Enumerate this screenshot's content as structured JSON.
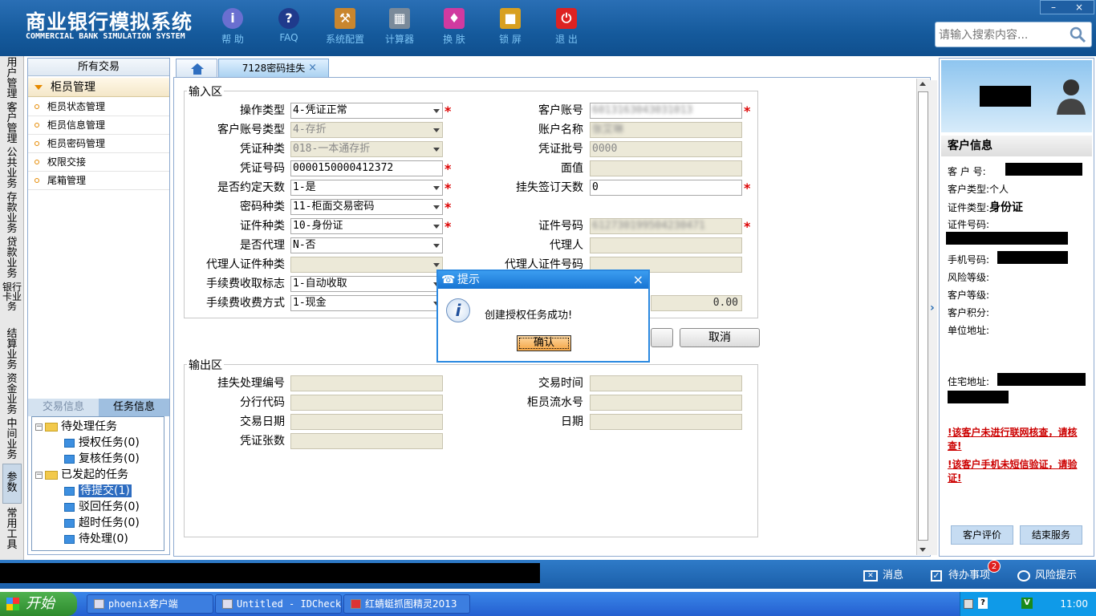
{
  "header": {
    "title": "商业银行模拟系统",
    "subtitle": "COMMERCIAL BANK SIMULATION SYSTEM",
    "toolbar": [
      {
        "label": "帮 助",
        "icon": "info-icon"
      },
      {
        "label": "FAQ",
        "icon": "question-icon"
      },
      {
        "label": "系统配置",
        "icon": "toolbox-icon"
      },
      {
        "label": "计算器",
        "icon": "calculator-icon"
      },
      {
        "label": "换 肤",
        "icon": "shirt-icon"
      },
      {
        "label": "锁 屏",
        "icon": "lock-icon"
      },
      {
        "label": "退 出",
        "icon": "power-icon"
      }
    ],
    "search_placeholder": "请输入搜索内容..."
  },
  "vtabs": [
    "用户管理",
    "客户管理",
    "公共业务",
    "存款业务",
    "贷款业务",
    "银行卡业务",
    "结算业务",
    "资金业务",
    "中间业务",
    "参数",
    "常用工具"
  ],
  "left": {
    "all_transactions": "所有交易",
    "section": "柜员管理",
    "items": [
      "柜员状态管理",
      "柜员信息管理",
      "柜员密码管理",
      "权限交接",
      "尾箱管理"
    ],
    "tabs": [
      "交易信息",
      "任务信息"
    ],
    "tree": {
      "pending": "待处理任务",
      "auth": "授权任务(0)",
      "review": "复核任务(0)",
      "initiated": "已发起的任务",
      "to_submit": "待提交(1)",
      "rejected": "驳回任务(0)",
      "timeout": "超时任务(0)",
      "processing": "待处理(0)"
    }
  },
  "tab": {
    "label": "7128密码挂失",
    "close": "×"
  },
  "input_area": {
    "title": "输入区",
    "left_fields": [
      {
        "label": "操作类型",
        "value": "4-凭证正常"
      },
      {
        "label": "客户账号类型",
        "value": "4-存折"
      },
      {
        "label": "凭证种类",
        "value": "018-一本通存折"
      },
      {
        "label": "凭证号码",
        "value": "0000150000412372"
      },
      {
        "label": "是否约定天数",
        "value": "1-是"
      },
      {
        "label": "密码种类",
        "value": "11-柜面交易密码"
      },
      {
        "label": "证件种类",
        "value": "10-身份证"
      },
      {
        "label": "是否代理",
        "value": "N-否"
      },
      {
        "label": "代理人证件种类",
        "value": ""
      },
      {
        "label": "手续费收取标志",
        "value": "1-自动收取"
      },
      {
        "label": "手续费收费方式",
        "value": "1-现金"
      }
    ],
    "right_fields": [
      {
        "label": "客户账号",
        "value": "6013163043031013"
      },
      {
        "label": "账户名称",
        "value": "张艾琳"
      },
      {
        "label": "凭证批号",
        "value": "0000"
      },
      {
        "label": "面值",
        "value": ""
      },
      {
        "label": "挂失签订天数",
        "value": "0"
      },
      {
        "label": "证件号码",
        "value": "612730199504230471"
      },
      {
        "label": "代理人",
        "value": ""
      },
      {
        "label": "代理人证件号码",
        "value": ""
      }
    ],
    "fee_value": "0.00",
    "cancel": "取消"
  },
  "output_area": {
    "title": "输出区",
    "left_fields": [
      "挂失处理编号",
      "分行代码",
      "交易日期",
      "凭证张数"
    ],
    "right_fields": [
      "交易时间",
      "柜员流水号",
      "日期"
    ]
  },
  "dialog": {
    "title": "提示",
    "message": "创建授权任务成功!",
    "ok": "确认"
  },
  "customer": {
    "heading": "客户信息",
    "id_label": "客 户 号:",
    "type_label": "客户类型:",
    "type_value": "个人",
    "doc_type_label": "证件类型:",
    "doc_type_value": "身份证",
    "doc_no_label": "证件号码:",
    "mobile_label": "手机号码:",
    "risk_label": "风险等级:",
    "level_label": "客户等级:",
    "points_label": "客户积分:",
    "company_label": "单位地址:",
    "home_label": "住宅地址:",
    "warn1": "!该客户未进行联网核查，请核查!",
    "warn2": "!该客户手机未短信验证，请验证!",
    "eval": "客户评价",
    "end": "结束服务"
  },
  "status": {
    "messages": "消息",
    "todo": "待办事项",
    "todo_count": "2",
    "risk": "风险提示"
  },
  "taskbar": {
    "start": "开始",
    "tasks": [
      "phoenix客户端",
      "Untitled - IDCheck",
      "红蜻蜓抓图精灵2013"
    ],
    "clock": "11:00"
  },
  "window": {
    "minimize": "–",
    "close": "×"
  },
  "colors": {
    "header": "#155a9c",
    "accent": "#2a88e0",
    "required": "#dd0000",
    "warning": "#cc0000"
  }
}
